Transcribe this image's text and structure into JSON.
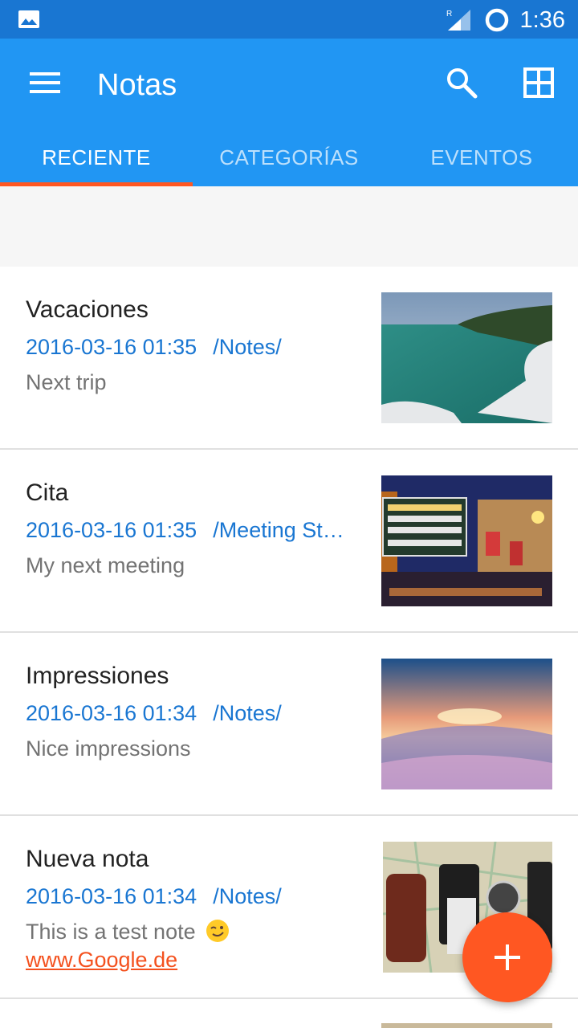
{
  "status_bar": {
    "time": "1:36",
    "icons": [
      "image-icon",
      "signal-icon",
      "sync-ring-icon"
    ],
    "signal_label": "R"
  },
  "app_bar": {
    "title": "Notas",
    "icons": [
      "menu-icon",
      "search-icon",
      "grid-view-icon"
    ]
  },
  "tabs": [
    {
      "label": "RECIENTE",
      "active": true
    },
    {
      "label": "CATEGORÍAS",
      "active": false
    },
    {
      "label": "EVENTOS",
      "active": false
    }
  ],
  "notes": [
    {
      "title": "Vacaciones",
      "date": "2016-03-16 01:35",
      "path": "/Notes/",
      "body": "Next trip",
      "thumbnail": "coastal-lake-photo"
    },
    {
      "title": "Cita",
      "date": "2016-03-16 01:35",
      "path": "/Meeting St…",
      "body": "My next meeting",
      "thumbnail": "city-street-signs-photo"
    },
    {
      "title": "Impressiones",
      "date": "2016-03-16 01:34",
      "path": "/Notes/",
      "body": "Nice impressions",
      "thumbnail": "sunset-sea-photo"
    },
    {
      "title": "Nueva nota",
      "date": "2016-03-16 01:34",
      "path": "/Notes/",
      "body": "This is a test note",
      "body_emoji": "wink-emoji",
      "link": "www.Google.de",
      "thumbnail": "travel-gear-photo"
    }
  ],
  "fab": {
    "icon": "plus-icon"
  },
  "colors": {
    "status_bar": "#1976D2",
    "app_bar": "#2196F3",
    "accent": "#FF5722",
    "meta_text": "#1976D2",
    "link": "#F4511E"
  }
}
